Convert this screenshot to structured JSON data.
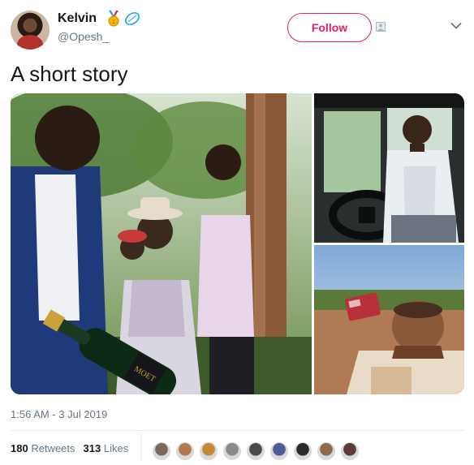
{
  "header": {
    "name": "Kelvin",
    "handle": "@Opesh_",
    "follow_label": "Follow"
  },
  "tweet": {
    "text": "A short story",
    "timestamp": "1:56 AM - 3 Jul 2019"
  },
  "stats": {
    "retweets_count": "180",
    "retweets_label": "Retweets",
    "likes_count": "313",
    "likes_label": "Likes"
  },
  "photo_text": {
    "bottle_label": "MOET"
  },
  "likers": [
    {
      "color": "#7a6a5e"
    },
    {
      "color": "#b07a4e"
    },
    {
      "color": "#c48a3a"
    },
    {
      "color": "#8a8a8a"
    },
    {
      "color": "#4a4a4a"
    },
    {
      "color": "#4a5c9a"
    },
    {
      "color": "#2a2a2a"
    },
    {
      "color": "#8c6a4c"
    },
    {
      "color": "#5a3a3a"
    }
  ],
  "colors": {
    "follow_accent": "#e0245e",
    "text_primary": "#14171a",
    "text_secondary": "#657786"
  }
}
